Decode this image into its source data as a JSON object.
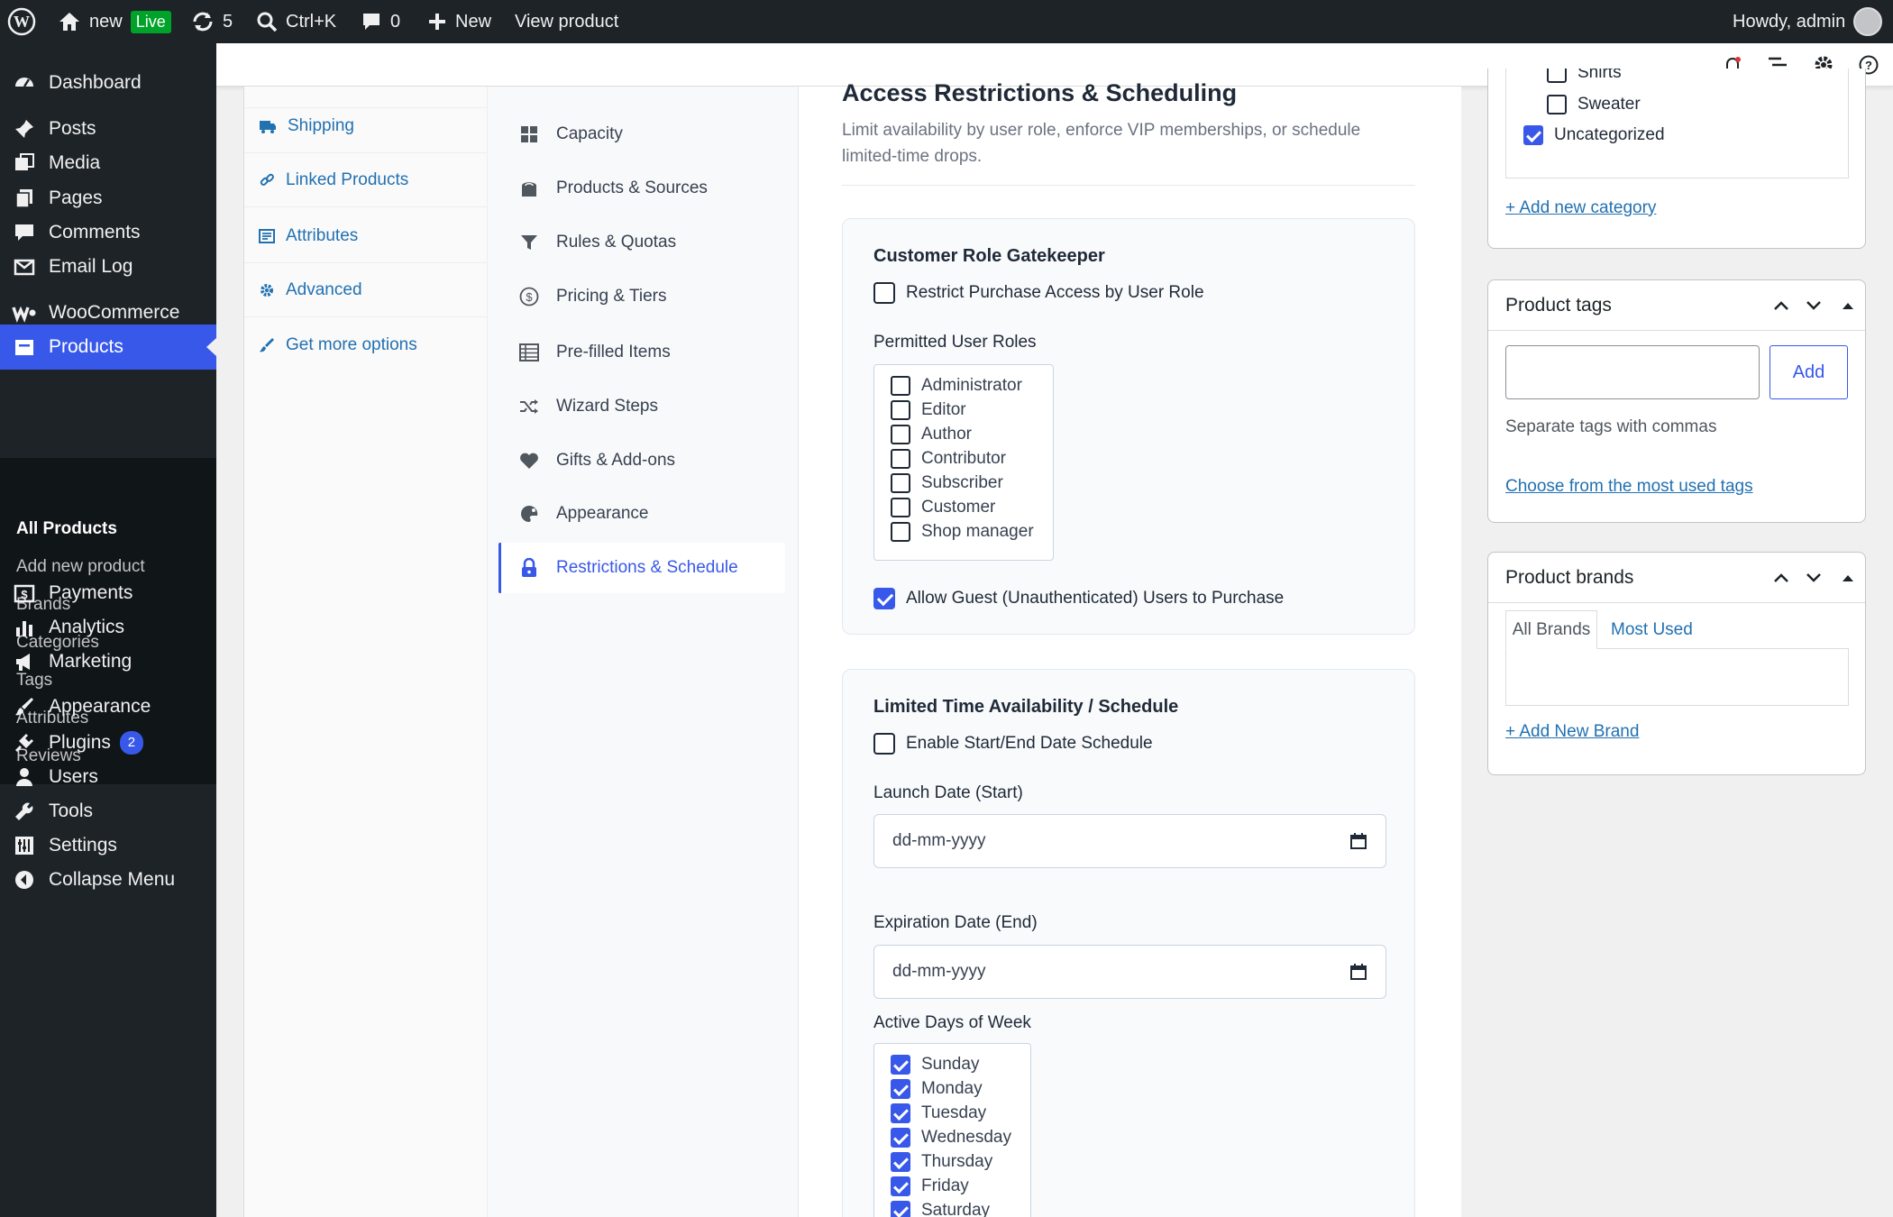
{
  "adminbar": {
    "site_name": "new",
    "live_badge": "Live",
    "updates_count": "5",
    "search_shortcut": "Ctrl+K",
    "comments_count": "0",
    "new_label": "New",
    "view_product": "View product",
    "greeting": "Howdy, admin"
  },
  "sidebar": {
    "items": [
      {
        "label": "Dashboard",
        "icon": "dashboard-icon"
      },
      {
        "label": "Posts",
        "icon": "pin-icon"
      },
      {
        "label": "Media",
        "icon": "media-icon"
      },
      {
        "label": "Pages",
        "icon": "pages-icon"
      },
      {
        "label": "Comments",
        "icon": "comment-icon"
      },
      {
        "label": "Email Log",
        "icon": "email-icon"
      },
      {
        "label": "WooCommerce",
        "icon": "woocommerce-icon"
      },
      {
        "label": "Products",
        "icon": "products-icon"
      },
      {
        "label": "Payments",
        "icon": "payments-icon"
      },
      {
        "label": "Analytics",
        "icon": "analytics-icon"
      },
      {
        "label": "Marketing",
        "icon": "megaphone-icon"
      },
      {
        "label": "Appearance",
        "icon": "brush-icon"
      },
      {
        "label": "Plugins",
        "icon": "plugin-icon",
        "badge": "2"
      },
      {
        "label": "Users",
        "icon": "users-icon"
      },
      {
        "label": "Tools",
        "icon": "wrench-icon"
      },
      {
        "label": "Settings",
        "icon": "settings-icon"
      },
      {
        "label": "Collapse Menu",
        "icon": "collapse-icon"
      }
    ],
    "submenu": [
      "All Products",
      "Add new product",
      "Brands",
      "Categories",
      "Tags",
      "Attributes",
      "Reviews"
    ]
  },
  "product_tabs": [
    "Shipping",
    "Linked Products",
    "Attributes",
    "Advanced",
    "Get more options"
  ],
  "subnav": [
    "Capacity",
    "Products & Sources",
    "Rules & Quotas",
    "Pricing & Tiers",
    "Pre-filled Items",
    "Wizard Steps",
    "Gifts & Add-ons",
    "Appearance",
    "Restrictions & Schedule"
  ],
  "content": {
    "title": "Access Restrictions & Scheduling",
    "description_line1": "Limit availability by user role, enforce VIP memberships, or schedule",
    "description_line2": "limited-time drops.",
    "gatekeeper": {
      "heading": "Customer Role Gatekeeper",
      "restrict_label": "Restrict Purchase Access by User Role",
      "roles_label": "Permitted User Roles",
      "roles": [
        "Administrator",
        "Editor",
        "Author",
        "Contributor",
        "Subscriber",
        "Customer",
        "Shop manager"
      ],
      "guest_label": "Allow Guest (Unauthenticated) Users to Purchase"
    },
    "schedule": {
      "heading": "Limited Time Availability / Schedule",
      "enable_label": "Enable Start/End Date Schedule",
      "launch_label": "Launch Date (Start)",
      "launch_placeholder": "dd-mm-yyyy",
      "expiration_label": "Expiration Date (End)",
      "expiration_placeholder": "dd-mm-yyyy",
      "days_label": "Active Days of Week",
      "days": [
        "Sunday",
        "Monday",
        "Tuesday",
        "Wednesday",
        "Thursday",
        "Friday",
        "Saturday"
      ]
    }
  },
  "categories_box": {
    "items": [
      "Shirts",
      "Sweater",
      "Uncategorized"
    ],
    "add_link": "+ Add new category"
  },
  "tags_box": {
    "title": "Product tags",
    "add_button": "Add",
    "hint": "Separate tags with commas",
    "most_used_link": "Choose from the most used tags"
  },
  "brands_box": {
    "title": "Product brands",
    "tab_all": "All Brands",
    "tab_most": "Most Used",
    "add_link": "+ Add New Brand"
  },
  "colors": {
    "accent": "#3858e9",
    "link": "#2271b1",
    "adminbar": "#1d2327"
  }
}
